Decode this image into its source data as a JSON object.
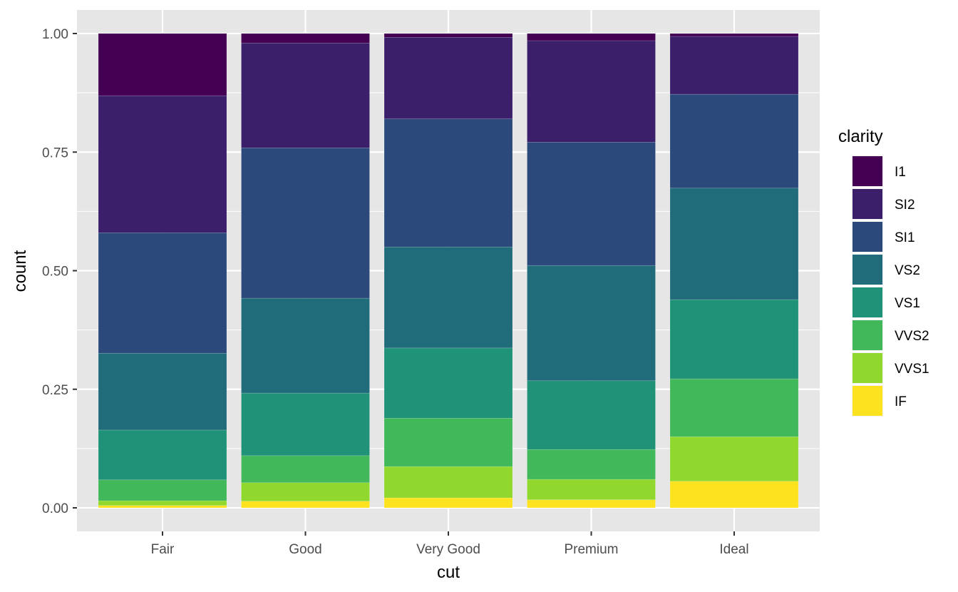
{
  "chart_data": {
    "type": "bar",
    "stacking": "fill",
    "title": "",
    "xlabel": "cut",
    "ylabel": "count",
    "ylim": [
      0,
      1
    ],
    "yticks": [
      "0.00",
      "0.25",
      "0.50",
      "0.75",
      "1.00"
    ],
    "ytick_values": [
      0,
      0.25,
      0.5,
      0.75,
      1.0
    ],
    "categories": [
      "Fair",
      "Good",
      "Very Good",
      "Premium",
      "Ideal"
    ],
    "legend": {
      "title": "clarity",
      "placement": "right"
    },
    "series": [
      {
        "name": "I1",
        "color": "#440154",
        "values": [
          0.131,
          0.02,
          0.008,
          0.015,
          0.006
        ]
      },
      {
        "name": "SI2",
        "color": "#3B1F6B",
        "values": [
          0.289,
          0.221,
          0.172,
          0.214,
          0.122
        ]
      },
      {
        "name": "SI1",
        "color": "#2B4A7B",
        "values": [
          0.254,
          0.317,
          0.27,
          0.26,
          0.198
        ]
      },
      {
        "name": "VS2",
        "color": "#216C7B",
        "values": [
          0.162,
          0.2,
          0.213,
          0.243,
          0.235
        ]
      },
      {
        "name": "VS1",
        "color": "#209278",
        "values": [
          0.105,
          0.132,
          0.148,
          0.145,
          0.167
        ]
      },
      {
        "name": "VVS2",
        "color": "#41B85A",
        "values": [
          0.044,
          0.057,
          0.102,
          0.063,
          0.122
        ]
      },
      {
        "name": "VVS1",
        "color": "#90D72E",
        "values": [
          0.01,
          0.039,
          0.066,
          0.043,
          0.094
        ]
      },
      {
        "name": "IF",
        "color": "#FDE31F",
        "values": [
          0.005,
          0.014,
          0.021,
          0.017,
          0.056
        ]
      }
    ],
    "grid": true
  },
  "theme": {
    "panel_bg": "#E6E6E6",
    "grid_major": "#FFFFFF",
    "text": "#4D4D4D",
    "title_text": "#000000"
  }
}
